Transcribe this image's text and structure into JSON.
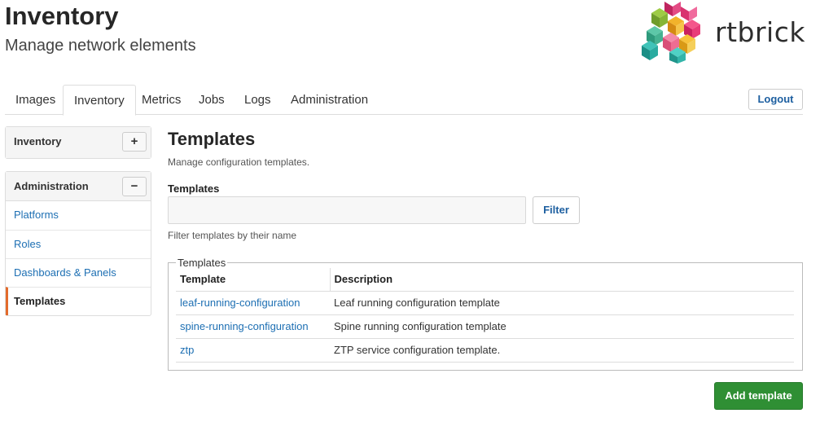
{
  "header": {
    "title": "Inventory",
    "subtitle": "Manage network elements",
    "logo_text": "rtbrick"
  },
  "tabs": [
    {
      "label": "Images",
      "active": false
    },
    {
      "label": "Inventory",
      "active": true
    },
    {
      "label": "Metrics",
      "active": false
    },
    {
      "label": "Jobs",
      "active": false
    },
    {
      "label": "Logs",
      "active": false
    },
    {
      "label": "Administration",
      "active": false
    }
  ],
  "logout_label": "Logout",
  "sidebar": {
    "inventory_panel": {
      "title": "Inventory",
      "toggle": "+"
    },
    "admin_panel": {
      "title": "Administration",
      "toggle": "−",
      "items": [
        {
          "label": "Platforms",
          "active": false
        },
        {
          "label": "Roles",
          "active": false
        },
        {
          "label": "Dashboards & Panels",
          "active": false
        },
        {
          "label": "Templates",
          "active": true
        }
      ]
    }
  },
  "main": {
    "title": "Templates",
    "description": "Manage configuration templates.",
    "filter": {
      "label": "Templates",
      "value": "",
      "placeholder": "",
      "button_label": "Filter",
      "help": "Filter templates by their name"
    },
    "table": {
      "legend": "Templates",
      "headers": [
        "Template",
        "Description"
      ],
      "rows": [
        {
          "name": "leaf-running-configuration",
          "description": "Leaf running configuration template"
        },
        {
          "name": "spine-running-configuration",
          "description": "Spine running configuration template"
        },
        {
          "name": "ztp",
          "description": "ZTP service configuration template."
        }
      ]
    },
    "add_button_label": "Add template"
  },
  "colors": {
    "link": "#1d6fb3",
    "active_accent": "#e36b2c",
    "primary_button": "#2f8f34"
  }
}
